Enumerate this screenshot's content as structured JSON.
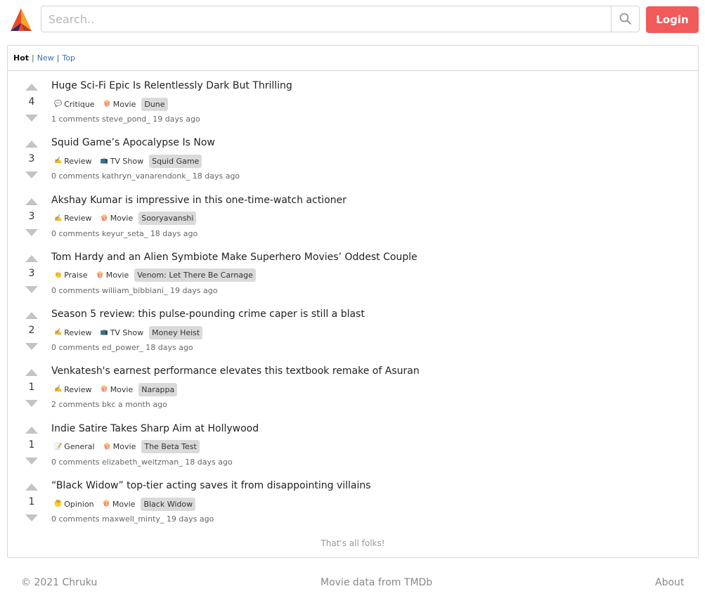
{
  "header": {
    "search_placeholder": "Search..",
    "login_label": "Login",
    "accent_color": "#f05a5a"
  },
  "sort_bar": {
    "items": [
      {
        "label": "Hot",
        "active": true
      },
      {
        "label": "New",
        "active": false
      },
      {
        "label": "Top",
        "active": false
      }
    ],
    "separator": "|"
  },
  "posts": [
    {
      "votes": "4",
      "title": "Huge Sci-Fi Epic Is Relentlessly Dark But Thrilling",
      "category_icon": "💬",
      "category": "Critique",
      "media_icon": "🍿",
      "media": "Movie",
      "chip": "Dune",
      "comments": "1 comments",
      "author": "steve_pond_",
      "time": "19 days ago"
    },
    {
      "votes": "3",
      "title": "Squid Game’s Apocalypse Is Now",
      "category_icon": "✍️",
      "category": "Review",
      "media_icon": "📺",
      "media": "TV Show",
      "chip": "Squid Game",
      "comments": "0 comments",
      "author": "kathryn_vanarendonk_",
      "time": "18 days ago"
    },
    {
      "votes": "3",
      "title": "Akshay Kumar is impressive in this one-time-watch actioner",
      "category_icon": "✍️",
      "category": "Review",
      "media_icon": "🍿",
      "media": "Movie",
      "chip": "Sooryavanshi",
      "comments": "0 comments",
      "author": "keyur_seta_",
      "time": "18 days ago"
    },
    {
      "votes": "3",
      "title": "Tom Hardy and an Alien Symbiote Make Superhero Movies’ Oddest Couple",
      "category_icon": "👏",
      "category": "Praise",
      "media_icon": "🍿",
      "media": "Movie",
      "chip": "Venom: Let There Be Carnage",
      "comments": "0 comments",
      "author": "william_bibbiani_",
      "time": "19 days ago"
    },
    {
      "votes": "2",
      "title": "Season 5 review: this pulse-pounding crime caper is still a blast",
      "category_icon": "✍️",
      "category": "Review",
      "media_icon": "📺",
      "media": "TV Show",
      "chip": "Money Heist",
      "comments": "0 comments",
      "author": "ed_power_",
      "time": "18 days ago"
    },
    {
      "votes": "1",
      "title": "Venkatesh's earnest performance elevates this textbook remake of Asuran",
      "category_icon": "✍️",
      "category": "Review",
      "media_icon": "🍿",
      "media": "Movie",
      "chip": "Narappa",
      "comments": "2 comments",
      "author": "bkc",
      "time": "a month ago"
    },
    {
      "votes": "1",
      "title": "Indie Satire Takes Sharp Aim at Hollywood",
      "category_icon": "📝",
      "category": "General",
      "media_icon": "🍿",
      "media": "Movie",
      "chip": "The Beta Test",
      "comments": "0 comments",
      "author": "elizabeth_weitzman_",
      "time": "18 days ago"
    },
    {
      "votes": "1",
      "title": "“Black Widow” top-tier acting saves it from disappointing villains",
      "category_icon": "🤔",
      "category": "Opinion",
      "media_icon": "🍿",
      "media": "Movie",
      "chip": "Black Widow",
      "comments": "0 comments",
      "author": "maxwell_minty_",
      "time": "19 days ago"
    }
  ],
  "end_note": "That's all folks!",
  "footer": {
    "copyright": "© 2021 Chruku",
    "credit": "Movie data from TMDb",
    "about": "About"
  }
}
